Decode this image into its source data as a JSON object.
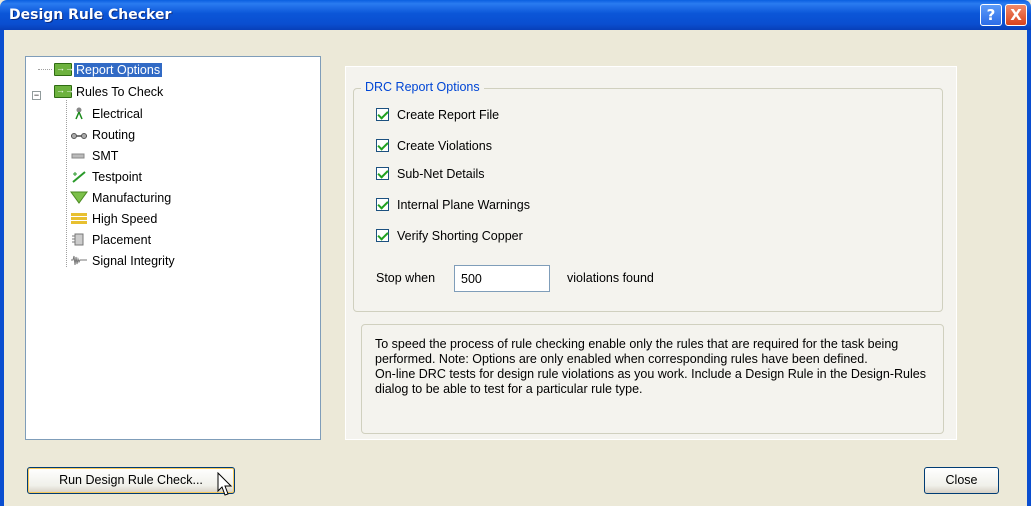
{
  "window": {
    "title": "Design Rule Checker",
    "help_glyph": "?",
    "close_glyph": "X"
  },
  "tree": {
    "items": [
      {
        "label": "Report Options",
        "icon": "folder-report-icon",
        "selected": true
      },
      {
        "label": "Rules To Check",
        "icon": "folder-rules-icon",
        "expander": "−"
      },
      {
        "label": "Electrical",
        "icon": "electrical-icon"
      },
      {
        "label": "Routing",
        "icon": "routing-icon"
      },
      {
        "label": "SMT",
        "icon": "smt-icon"
      },
      {
        "label": "Testpoint",
        "icon": "testpoint-icon"
      },
      {
        "label": "Manufacturing",
        "icon": "manufacturing-icon"
      },
      {
        "label": "High Speed",
        "icon": "high-speed-icon"
      },
      {
        "label": "Placement",
        "icon": "placement-icon"
      },
      {
        "label": "Signal Integrity",
        "icon": "signal-integrity-icon"
      }
    ]
  },
  "report_options": {
    "group_title": "DRC Report Options",
    "checkboxes": [
      {
        "label": "Create Report File",
        "checked": true
      },
      {
        "label": "Create Violations",
        "checked": true
      },
      {
        "label": "Sub-Net Details",
        "checked": true
      },
      {
        "label": "Internal Plane Warnings",
        "checked": true
      },
      {
        "label": "Verify Shorting Copper",
        "checked": true
      }
    ],
    "stop_label": "Stop when",
    "stop_value": "500",
    "violations_label": "violations found"
  },
  "info": {
    "text": "To speed the process of rule checking enable only the rules that are required for the task being performed.  Note: Options are only enabled when corresponding rules have been defined.\nOn-line DRC tests for design rule violations as you work. Include a Design Rule in the Design-Rules dialog to be able to test for a particular rule  type."
  },
  "buttons": {
    "run_label": "Run Design Rule Check...",
    "close_label": "Close"
  },
  "colors": {
    "titlebar": "#0a4ed0",
    "selection": "#316ac5",
    "group_title": "#0046d5",
    "checkmark": "#21a121"
  }
}
